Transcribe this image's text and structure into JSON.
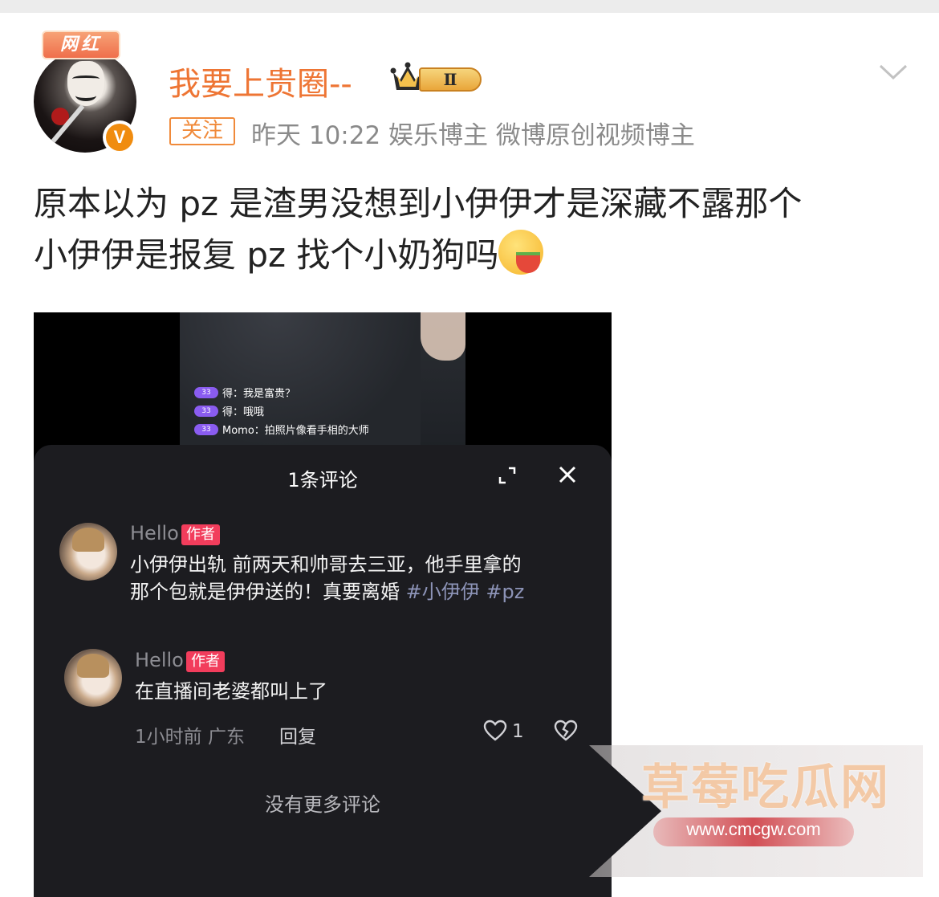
{
  "header": {
    "badge_label": "网红",
    "username": "我要上贵圈--",
    "level_label": "Ⅱ",
    "follow_label": "关注",
    "meta_text": "昨天 10:22  娱乐博主 微博原创视频博主",
    "verified_badge_label": "V"
  },
  "post": {
    "line1": "原本以为 pz 是渣男没想到小伊伊才是深藏不露那个",
    "line2": "小伊伊是报复 pz 找个小奶狗吗"
  },
  "video": {
    "chat": [
      {
        "level": "33",
        "text": "得：我是富贵？"
      },
      {
        "level": "33",
        "text": "得：哦哦"
      },
      {
        "level": "33",
        "text": "Momo：拍照片像看手相的大师"
      }
    ],
    "sheet_title": "1条评论",
    "comments": [
      {
        "author": "Hello",
        "author_tag": "作者",
        "line1": "小伊伊出轨 前两天和帅哥去三亚，他手里拿的",
        "line2": "那个包就是伊伊送的！真要离婚 ",
        "hashtags": "#小伊伊 #pz"
      },
      {
        "author": "Hello",
        "author_tag": "作者",
        "text": "在直播间老婆都叫上了",
        "time_location": "1小时前 广东",
        "reply_label": "回复",
        "like_count": "1"
      }
    ],
    "no_more_label": "没有更多评论"
  },
  "watermark": {
    "title": "草莓吃瓜网",
    "url": "www.cmcgw.com"
  },
  "colors": {
    "username": "#ee7534",
    "follow": "#f08a3a",
    "author_tag": "#f23d5c",
    "sheet_bg": "#1c1c20"
  },
  "icons": [
    "chevron-down-icon",
    "crown-icon",
    "expand-icon",
    "close-icon",
    "heart-icon",
    "broken-heart-icon"
  ]
}
